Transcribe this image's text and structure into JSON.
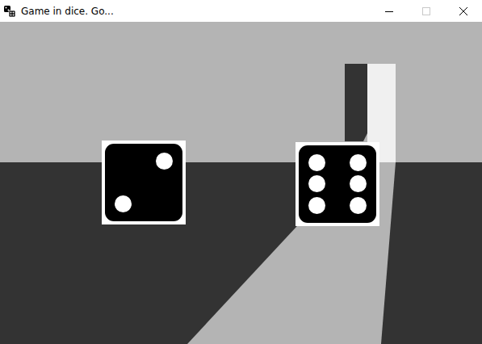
{
  "window": {
    "title": "Game in dice. Go..."
  },
  "dice": [
    {
      "value": 2
    },
    {
      "value": 6
    }
  ]
}
